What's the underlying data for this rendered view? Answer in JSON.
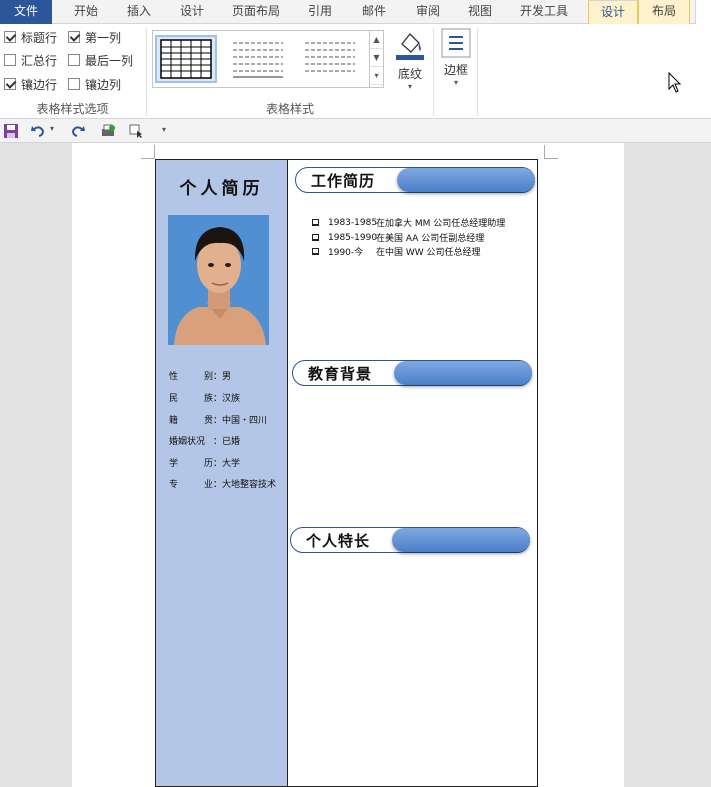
{
  "tabs": [
    "文件",
    "开始",
    "插入",
    "设计",
    "页面布局",
    "引用",
    "邮件",
    "审阅",
    "视图",
    "开发工具",
    "设计",
    "布局"
  ],
  "ribbon": {
    "style_options": {
      "header_row": "标题行",
      "first_column": "第一列",
      "total_row": "汇总行",
      "last_column": "最后一列",
      "banded_rows": "镶边行",
      "banded_columns": "镶边列",
      "group_label": "表格样式选项"
    },
    "table_styles_label": "表格样式",
    "shading": "底纹",
    "borders": "边框"
  },
  "resume": {
    "title": "个人简历",
    "info": [
      {
        "key": [
          "性",
          "别"
        ],
        "value": "男"
      },
      {
        "key": [
          "民",
          "族"
        ],
        "value": "汉族"
      },
      {
        "key": [
          "籍",
          "贯"
        ],
        "value": "中国・四川"
      },
      {
        "key": [
          "婚姻状况"
        ],
        "value": "已婚"
      },
      {
        "key": [
          "学",
          "历"
        ],
        "value": "大学"
      },
      {
        "key": [
          "专",
          "业"
        ],
        "value": "大地整容技术"
      }
    ],
    "sections": {
      "work": "工作简历",
      "education": "教育背景",
      "skills": "个人特长"
    },
    "work_items": [
      {
        "years": "1983-1985",
        "desc": "在加拿大 MM 公司任总经理助理"
      },
      {
        "years": "1985-1990",
        "desc": "在美国 AA 公司任副总经理"
      },
      {
        "years": "1990-今",
        "desc": "在中国 WW 公司任总经理"
      }
    ]
  },
  "colors": {
    "word_blue": "#2b579a",
    "left_column": "#b4c6e7",
    "section_bar": "#4a7fc9"
  }
}
